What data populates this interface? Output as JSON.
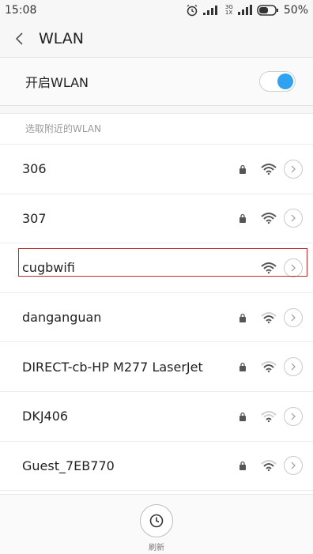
{
  "status": {
    "time": "15:08",
    "net_label": "3G\n1X",
    "battery": "50%"
  },
  "header": {
    "title": "WLAN"
  },
  "toggle": {
    "label": "开启WLAN",
    "state": "on"
  },
  "section": {
    "title": "选取附近的WLAN"
  },
  "networks": [
    {
      "name": "306",
      "locked": true,
      "signal": "strong"
    },
    {
      "name": "307",
      "locked": true,
      "signal": "strong"
    },
    {
      "name": "cugbwifi",
      "locked": false,
      "signal": "strong",
      "selected": true
    },
    {
      "name": "danganguan",
      "locked": true,
      "signal": "medium"
    },
    {
      "name": "DIRECT-cb-HP M277 LaserJet",
      "locked": true,
      "signal": "medium"
    },
    {
      "name": "DKJ406",
      "locked": true,
      "signal": "weak"
    },
    {
      "name": "Guest_7EB770",
      "locked": true,
      "signal": "medium"
    }
  ],
  "bottom": {
    "refresh_label": "刷新"
  },
  "colors": {
    "accent": "#2fa3f2",
    "highlight": "#c0282c"
  }
}
